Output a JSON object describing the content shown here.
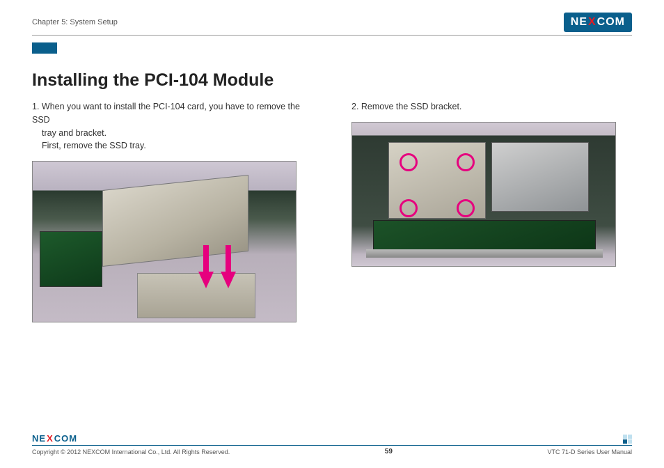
{
  "header": {
    "chapter": "Chapter 5: System Setup",
    "brand_left": "NE",
    "brand_x": "X",
    "brand_right": "COM"
  },
  "title": "Installing the PCI-104 Module",
  "steps": {
    "s1_line1": "1. When you want to install the PCI-104 card, you have to remove the SSD",
    "s1_line2": "tray and bracket.",
    "s1_line3": "First, remove the SSD tray.",
    "s2": "2. Remove the SSD bracket."
  },
  "figure1_alt": "Photograph of device interior showing SSD tray being slid out, with two magenta downward arrows indicating removal direction.",
  "figure2_alt": "Photograph of device interior with SSD bracket in place; four magenta circles mark the bracket screw locations.",
  "footer": {
    "copyright": "Copyright © 2012 NEXCOM International Co., Ltd. All Rights Reserved.",
    "page": "59",
    "manual": "VTC 71-D Series User Manual"
  }
}
